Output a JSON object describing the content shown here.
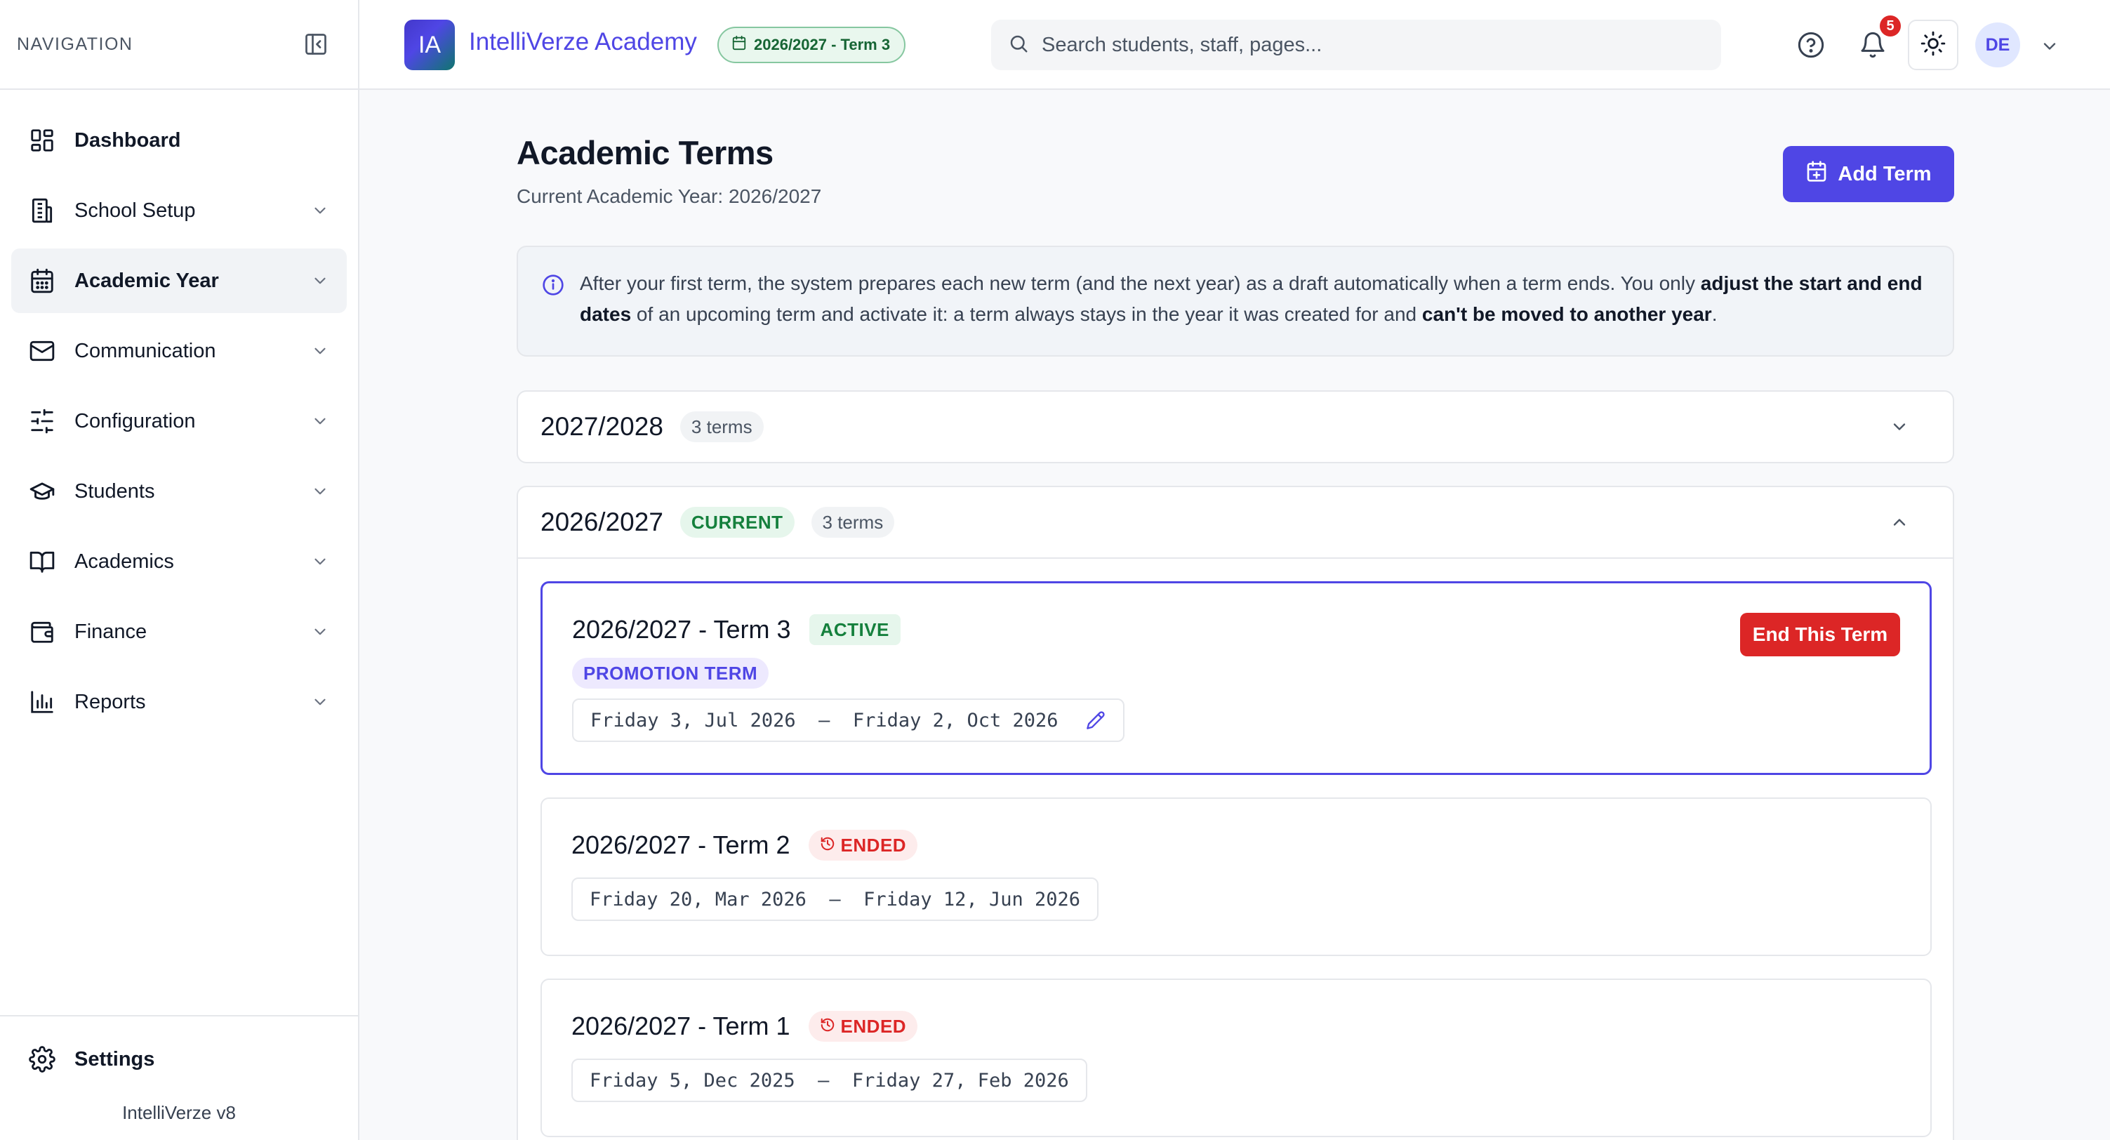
{
  "sidebar": {
    "title": "NAVIGATION",
    "items": [
      {
        "label": "Dashboard",
        "icon": "dashboard-icon"
      },
      {
        "label": "School Setup",
        "icon": "building-icon"
      },
      {
        "label": "Academic Year",
        "icon": "calendar-icon"
      },
      {
        "label": "Communication",
        "icon": "mail-icon"
      },
      {
        "label": "Configuration",
        "icon": "sliders-icon"
      },
      {
        "label": "Students",
        "icon": "graduation-cap-icon"
      },
      {
        "label": "Academics",
        "icon": "book-icon"
      },
      {
        "label": "Finance",
        "icon": "wallet-icon"
      },
      {
        "label": "Reports",
        "icon": "bar-chart-icon"
      }
    ],
    "settings_label": "Settings",
    "version": "IntelliVerze v8"
  },
  "topbar": {
    "logo_text": "IA",
    "app_name": "IntelliVerze Academy",
    "term_pill": "2026/2027 - Term 3",
    "search_placeholder": "Search students, staff, pages...",
    "notification_count": "5",
    "avatar_initials": "DE"
  },
  "page": {
    "title": "Academic Terms",
    "subtitle": "Current Academic Year: 2026/2027",
    "add_button": "Add Term",
    "info": {
      "part1": "After your first term, the system prepares each new term (and the next year) as a draft automatically when a term ends. You only ",
      "bold1": "adjust the start and end dates",
      "part2": " of an upcoming term and activate it: a term always stays in the year it was created for and ",
      "bold2": "can't be moved to another year",
      "part3": "."
    }
  },
  "years": [
    {
      "name": "2027/2028",
      "count": "3 terms",
      "expanded": false
    },
    {
      "name": "2026/2027",
      "current_label": "CURRENT",
      "count": "3 terms",
      "expanded": true,
      "terms": [
        {
          "name": "2026/2027 - Term 3",
          "status": "ACTIVE",
          "tag": "PROMOTION TERM",
          "start": "Friday 3, Jul 2026",
          "end": "Friday 2, Oct 2026",
          "action": "End This Term"
        },
        {
          "name": "2026/2027 - Term 2",
          "status": "ENDED",
          "start": "Friday 20, Mar 2026",
          "end": "Friday 12, Jun 2026"
        },
        {
          "name": "2026/2027 - Term 1",
          "status": "ENDED",
          "start": "Friday 5, Dec 2025",
          "end": "Friday 27, Feb 2026"
        }
      ]
    }
  ],
  "colors": {
    "accent": "#4f46e5",
    "danger": "#dc2626",
    "success": "#15803d"
  }
}
